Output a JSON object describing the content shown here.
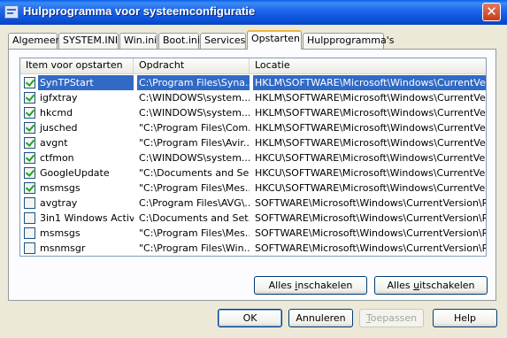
{
  "window": {
    "title": "Hulpprogramma voor systeemconfiguratie",
    "close_glyph": "✕"
  },
  "tabs": [
    {
      "label": "Algemeen"
    },
    {
      "label": "SYSTEM.INI"
    },
    {
      "label": "Win.ini"
    },
    {
      "label": "Boot.ini"
    },
    {
      "label": "Services"
    },
    {
      "label": "Opstarten"
    },
    {
      "label": "Hulpprogramma's"
    }
  ],
  "active_tab": "Opstarten",
  "list": {
    "columns": [
      "Item voor opstarten",
      "Opdracht",
      "Locatie"
    ],
    "rows": [
      {
        "item": "SynTPStart",
        "command": "C:\\Program Files\\Syna...",
        "location": "HKLM\\SOFTWARE\\Microsoft\\Windows\\CurrentVer...",
        "checked": true,
        "selected": true
      },
      {
        "item": "igfxtray",
        "command": "C:\\WINDOWS\\system...",
        "location": "HKLM\\SOFTWARE\\Microsoft\\Windows\\CurrentVer...",
        "checked": true
      },
      {
        "item": "hkcmd",
        "command": "C:\\WINDOWS\\system...",
        "location": "HKLM\\SOFTWARE\\Microsoft\\Windows\\CurrentVer...",
        "checked": true
      },
      {
        "item": "jusched",
        "command": "\"C:\\Program Files\\Com...",
        "location": "HKLM\\SOFTWARE\\Microsoft\\Windows\\CurrentVer...",
        "checked": true
      },
      {
        "item": "avgnt",
        "command": "\"C:\\Program Files\\Avir...",
        "location": "HKLM\\SOFTWARE\\Microsoft\\Windows\\CurrentVer...",
        "checked": true
      },
      {
        "item": "ctfmon",
        "command": "C:\\WINDOWS\\system...",
        "location": "HKCU\\SOFTWARE\\Microsoft\\Windows\\CurrentVer...",
        "checked": true
      },
      {
        "item": "GoogleUpdate",
        "command": "\"C:\\Documents and Se...",
        "location": "HKCU\\SOFTWARE\\Microsoft\\Windows\\CurrentVer...",
        "checked": true
      },
      {
        "item": "msmsgs",
        "command": "\"C:\\Program Files\\Mes...",
        "location": "HKCU\\SOFTWARE\\Microsoft\\Windows\\CurrentVer...",
        "checked": true
      },
      {
        "item": "avgtray",
        "command": "C:\\Program Files\\AVG\\...",
        "location": "SOFTWARE\\Microsoft\\Windows\\CurrentVersion\\Run",
        "checked": false
      },
      {
        "item": "3in1 Windows Activ...",
        "command": "C:\\Documents and Set...",
        "location": "SOFTWARE\\Microsoft\\Windows\\CurrentVersion\\Run",
        "checked": false
      },
      {
        "item": "msmsgs",
        "command": "\"C:\\Program Files\\Mes...",
        "location": "SOFTWARE\\Microsoft\\Windows\\CurrentVersion\\Run",
        "checked": false
      },
      {
        "item": "msnmsgr",
        "command": "\"C:\\Program Files\\Win...",
        "location": "SOFTWARE\\Microsoft\\Windows\\CurrentVersion\\Run",
        "checked": false
      }
    ]
  },
  "panel_buttons": {
    "enable_all_pre": "Alles ",
    "enable_all_accel": "i",
    "enable_all_post": "nschakelen",
    "disable_all_pre": "Alles ",
    "disable_all_accel": "u",
    "disable_all_post": "itschakelen"
  },
  "dialog_buttons": {
    "ok": "OK",
    "cancel": "Annuleren",
    "apply_accel": "T",
    "apply_post": "oepassen",
    "help": "Help"
  }
}
